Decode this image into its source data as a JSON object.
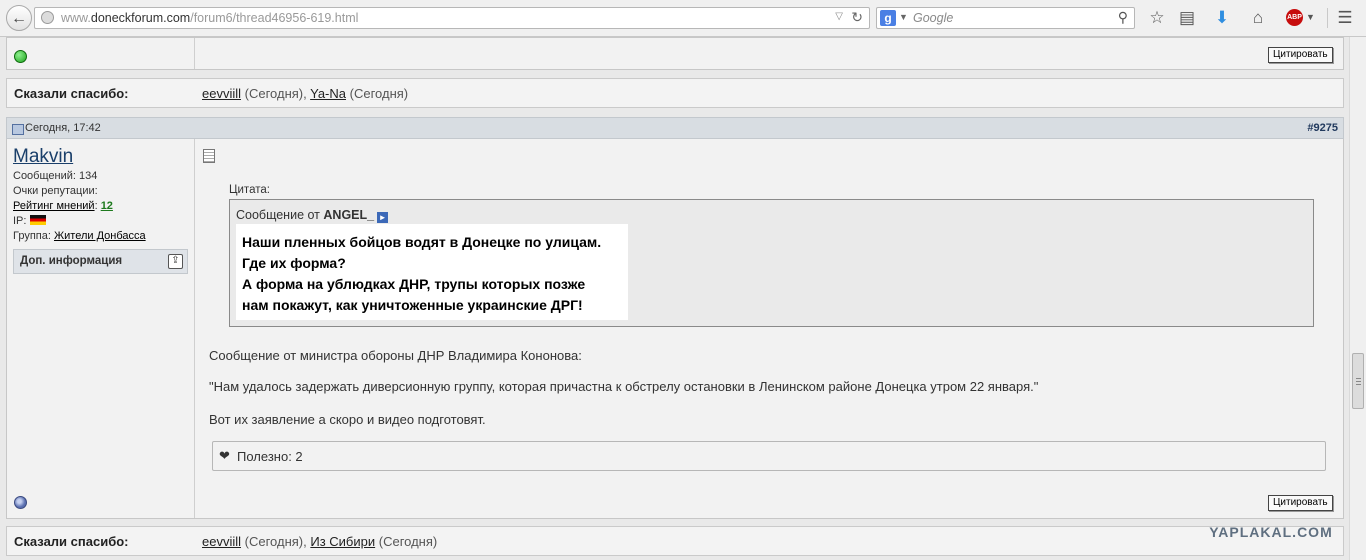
{
  "browser": {
    "url_prefix": "www.",
    "url_domain": "doneckforum.com",
    "url_path": "/forum6/thread46956-619.html",
    "search_placeholder": "Google",
    "search_engine_letter": "g",
    "abp_label": "ABP",
    "icons": [
      "back-arrow-icon",
      "globe-icon",
      "reload-icon",
      "search-icon",
      "star-icon",
      "reading-list-icon",
      "download-icon",
      "home-icon",
      "adblock-icon",
      "menu-icon"
    ]
  },
  "prev_post": {
    "quote_button": "Цитировать"
  },
  "thanks_top": {
    "label": "Сказали спасибо:",
    "users": [
      {
        "name": "eevviill",
        "when": "(Сегодня)",
        "sep": ", "
      },
      {
        "name": "Ya-Na",
        "when": "(Сегодня)",
        "sep": ""
      }
    ]
  },
  "post": {
    "date": "Сегодня, 17:42",
    "number": "#9275",
    "user": {
      "name": "Makvin",
      "posts_label": "Сообщений:",
      "posts_value": "134",
      "rep_label": "Очки репутации:",
      "rating_label": "Рейтинг мнений",
      "rating_value": "12",
      "ip_label": "IP:",
      "group_label": "Группа:",
      "group_value": "Жители Донбасса",
      "more_info": "Доп. информация"
    },
    "quote": {
      "label": "Цитата:",
      "from_prefix": "Сообщение от",
      "from_user": "ANGEL_",
      "lines": [
        "Наши пленных бойцов водят в Донецке по улицам.",
        "Где их форма?",
        "А форма на ублюдках ДНР, трупы которых позже",
        "нам покажут, как уничтоженные украинские ДРГ!"
      ]
    },
    "body_lines": [
      "Сообщение от министра обороны ДНР Владимира Кононова:",
      "\"Нам удалось задержать диверсионную группу, которая причастна к обстрелу остановки в Ленинском районе Донецка утром 22 января.\"",
      "Вот их заявление а скоро и видео подготовят."
    ],
    "useful": "Полезно: 2",
    "quote_button": "Цитировать"
  },
  "thanks_bottom": {
    "label": "Сказали спасибо:",
    "users": [
      {
        "name": "eevviill",
        "when": "(Сегодня)",
        "sep": ", "
      },
      {
        "name": "Из Сибири",
        "when": "(Сегодня)",
        "sep": ""
      }
    ]
  },
  "watermark": "YAPLAKAL.COM",
  "colors": {
    "online": "#1ea51e",
    "offline": "#5a6fb0",
    "username": "#1a3f6a",
    "rating_positive": "#1e7a1e",
    "abp": "#c70d0d",
    "download": "#2f8ee0"
  }
}
